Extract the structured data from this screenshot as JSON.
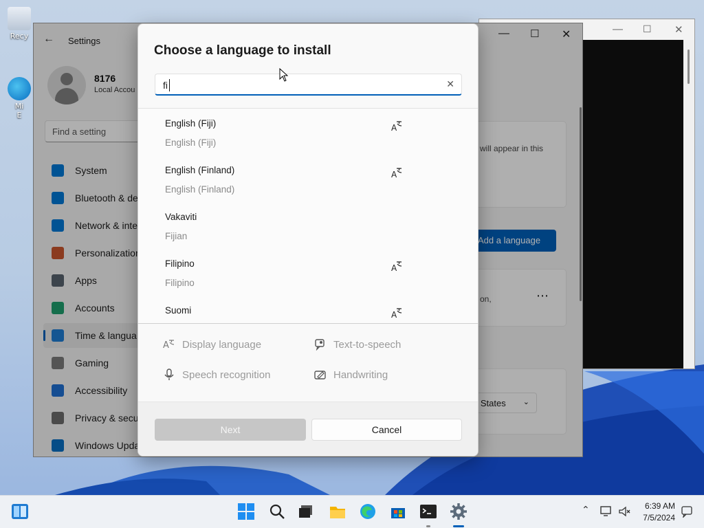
{
  "desktop": {
    "icons": [
      {
        "label": "Recy"
      },
      {
        "label": "Mi"
      },
      {
        "label": "E"
      }
    ]
  },
  "settings_window": {
    "title": "Settings",
    "user": {
      "name": "8176",
      "account_type": "Local Accou"
    },
    "search_placeholder": "Find a setting",
    "nav": [
      {
        "label": "System",
        "icon": "monitor-icon",
        "color": "#0078d4"
      },
      {
        "label": "Bluetooth & de",
        "icon": "bluetooth-icon",
        "color": "#0078d4"
      },
      {
        "label": "Network & inte",
        "icon": "wifi-icon",
        "color": "#0078d4"
      },
      {
        "label": "Personalization",
        "icon": "brush-icon",
        "color": "#c8552d"
      },
      {
        "label": "Apps",
        "icon": "apps-icon",
        "color": "#56626e"
      },
      {
        "label": "Accounts",
        "icon": "person-icon",
        "color": "#1f9e6e"
      },
      {
        "label": "Time & langua",
        "icon": "globe-clock-icon",
        "color": "#1f7bd1",
        "active": true
      },
      {
        "label": "Gaming",
        "icon": "controller-icon",
        "color": "#7a7a7a"
      },
      {
        "label": "Accessibility",
        "icon": "accessibility-icon",
        "color": "#1f6fd1"
      },
      {
        "label": "Privacy & secur",
        "icon": "shield-icon",
        "color": "#6b6b6b"
      },
      {
        "label": "Windows Upda",
        "icon": "update-icon",
        "color": "#0a6fc2"
      }
    ],
    "content": {
      "info_text": "will appear in this",
      "add_language_label": "Add a language",
      "partial_text": "on,",
      "more_label": "⋯",
      "region_value": "d States"
    }
  },
  "dialog": {
    "title": "Choose a language to install",
    "search_value": "fi",
    "clear_label": "✕",
    "languages": [
      {
        "name": "English (Fiji)",
        "native": "English (Fiji)",
        "has_display_language": true
      },
      {
        "name": "English (Finland)",
        "native": "English (Finland)",
        "has_display_language": true
      },
      {
        "name": "Vakaviti",
        "native": "Fijian",
        "has_display_language": false
      },
      {
        "name": "Filipino",
        "native": "Filipino",
        "has_display_language": true
      },
      {
        "name": "Suomi",
        "native": "",
        "has_display_language": true
      }
    ],
    "features": {
      "display_language": "Display language",
      "text_to_speech": "Text-to-speech",
      "speech_recognition": "Speech recognition",
      "handwriting": "Handwriting"
    },
    "next_label": "Next",
    "cancel_label": "Cancel"
  },
  "taskbar": {
    "time": "6:39 AM",
    "date": "7/5/2024",
    "apps": [
      {
        "icon": "windows-start-icon"
      },
      {
        "icon": "search-icon"
      },
      {
        "icon": "task-view-icon"
      },
      {
        "icon": "file-explorer-icon"
      },
      {
        "icon": "edge-browser-icon"
      },
      {
        "icon": "microsoft-store-icon"
      },
      {
        "icon": "terminal-icon"
      },
      {
        "icon": "settings-gear-icon"
      }
    ],
    "accent_color": "#005fb8"
  }
}
